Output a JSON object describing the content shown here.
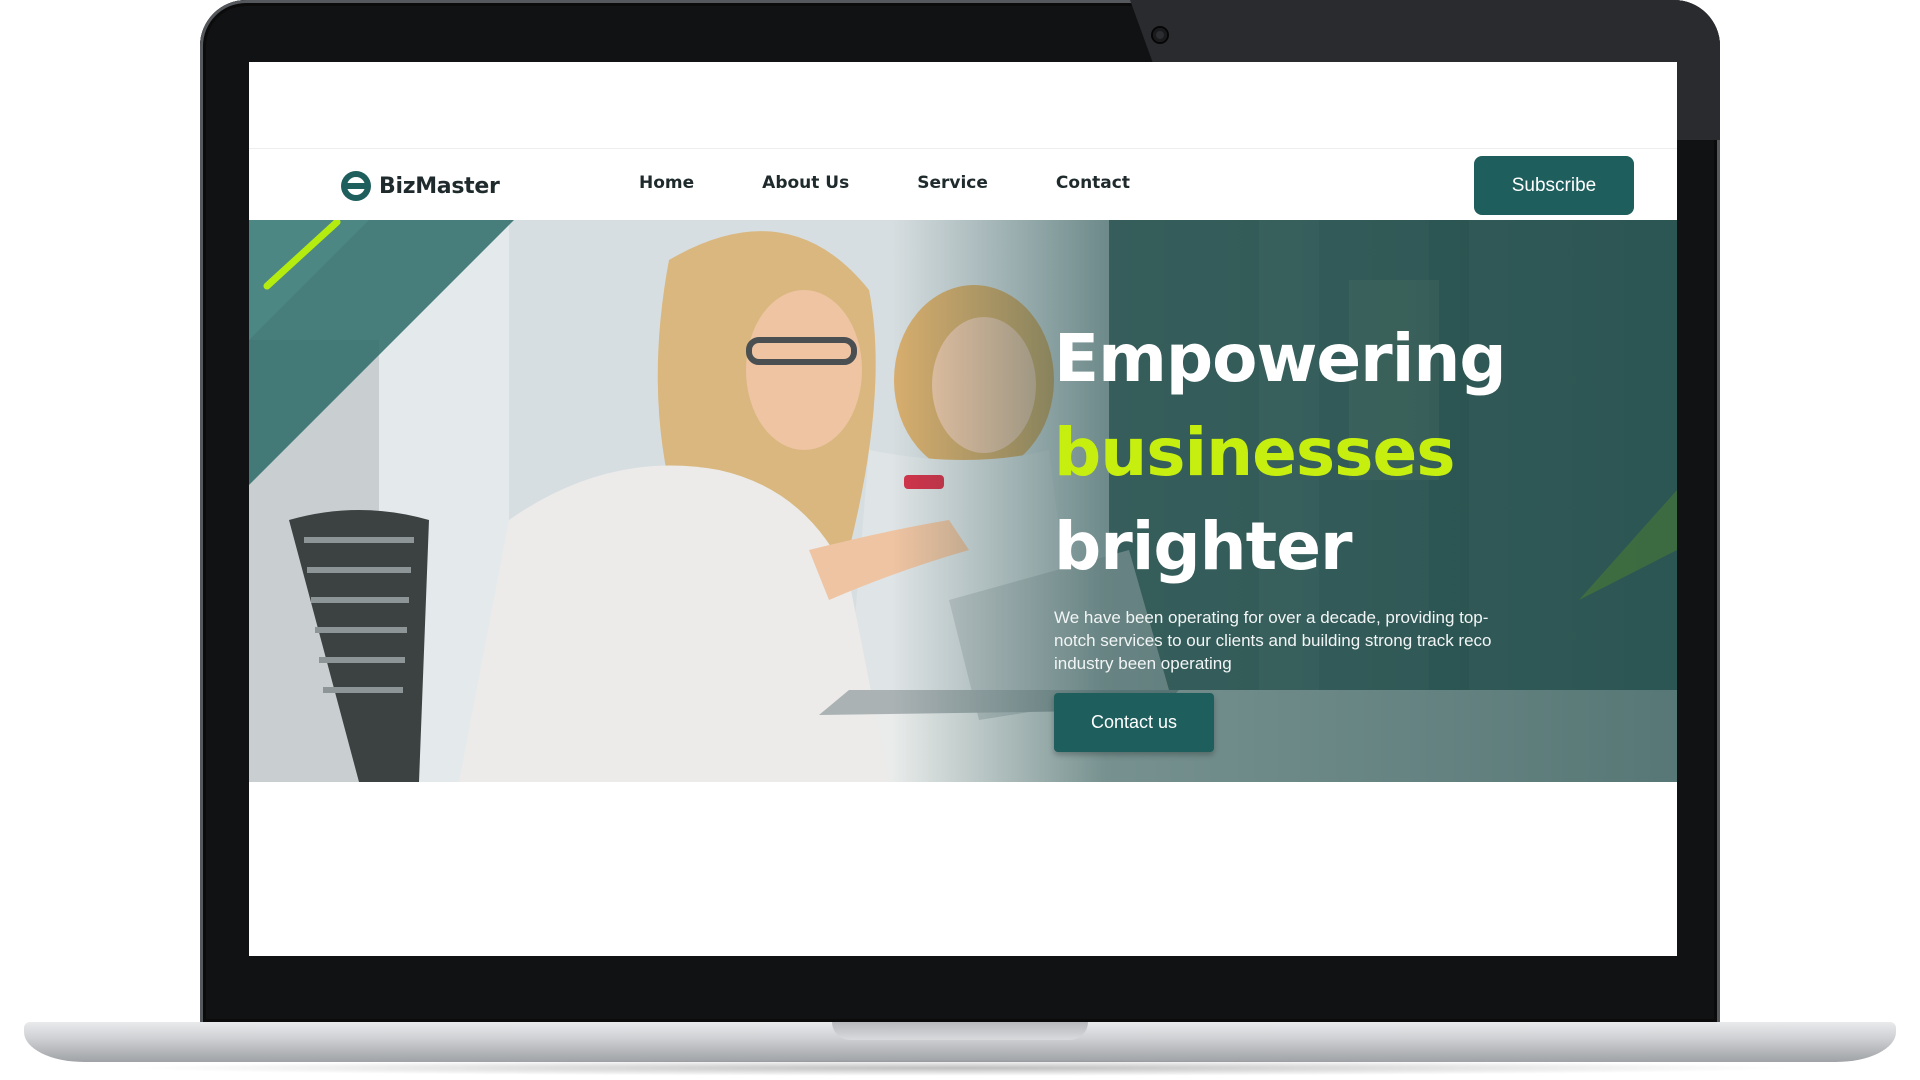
{
  "brand": {
    "name": "BizMaster",
    "logo_icon": "bizmaster-logo-icon",
    "color_primary": "#1e5e5d",
    "color_accent": "#c6ef10"
  },
  "nav": {
    "items": [
      {
        "label": "Home"
      },
      {
        "label": "About Us"
      },
      {
        "label": "Service"
      },
      {
        "label": "Contact"
      }
    ],
    "subscribe_label": "Subscribe"
  },
  "hero": {
    "headline_line1": "Empowering",
    "headline_line2": "businesses",
    "headline_line3": "brighter",
    "description": "We have been operating for over a decade, providing top-notch services to our clients and building strong track reco industry been operating",
    "cta_label": "Contact us",
    "image": "photo-two-women-working-at-laptop"
  }
}
